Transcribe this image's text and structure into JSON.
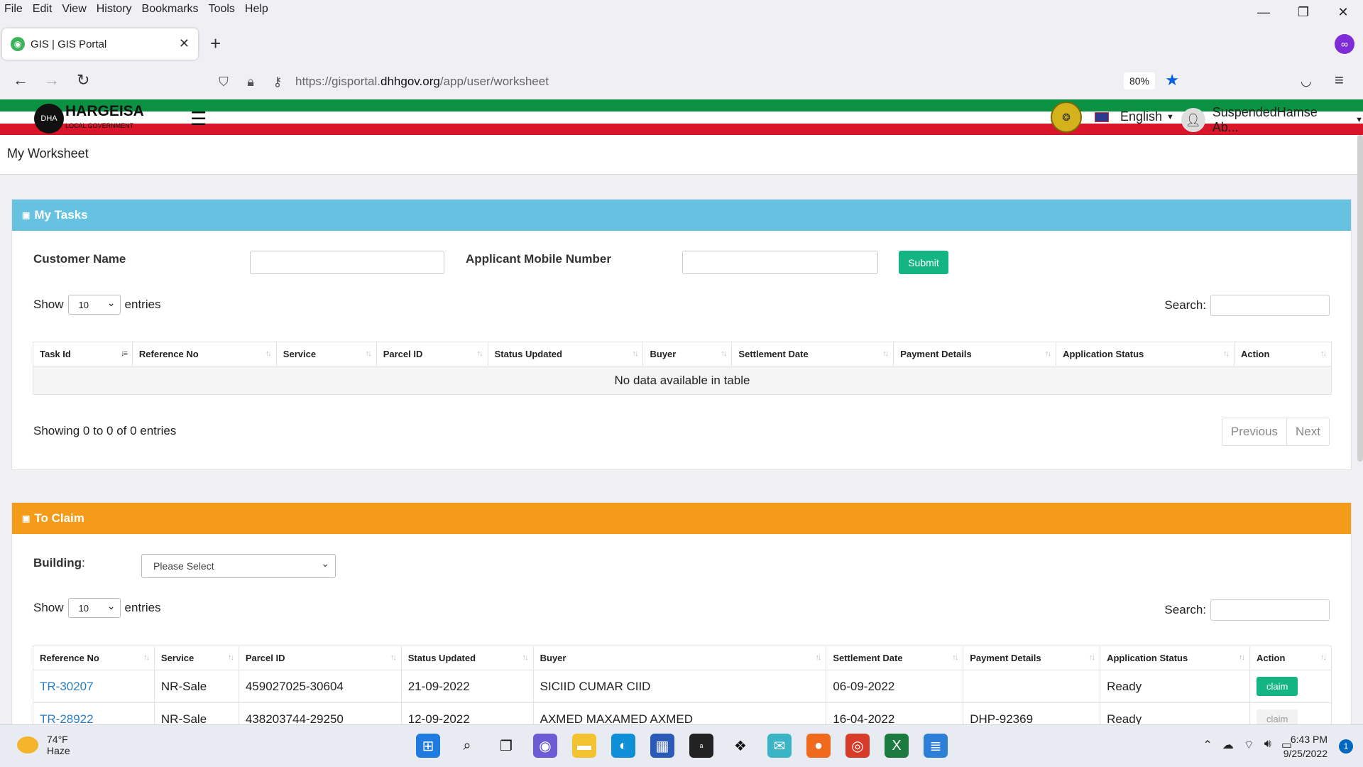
{
  "browser": {
    "menu": [
      "File",
      "Edit",
      "View",
      "History",
      "Bookmarks",
      "Tools",
      "Help"
    ],
    "tab_title": "GIS | GIS Portal",
    "url_prefix": "https://gisportal.",
    "url_domain": "dhhgov.org",
    "url_path": "/app/user/worksheet",
    "zoom": "80%"
  },
  "header": {
    "logo_initials": "DHA",
    "logo_title": "HARGEISA",
    "logo_subtitle": "LOCAL GOVERNMENT",
    "language": "English",
    "user_name": "SuspendedHamse Ab..."
  },
  "breadcrumb": "My Worksheet",
  "my_tasks": {
    "title": "My Tasks",
    "customer_name_label": "Customer Name",
    "mobile_label": "Applicant Mobile Number",
    "submit_label": "Submit",
    "show_label": "Show",
    "entries_label": "entries",
    "page_size": "10",
    "search_label": "Search:",
    "columns": [
      "Task Id",
      "Reference No",
      "Service",
      "Parcel ID",
      "Status Updated",
      "Buyer",
      "Settlement Date",
      "Payment Details",
      "Application Status",
      "Action"
    ],
    "empty_text": "No data available in table",
    "info_text": "Showing 0 to 0 of 0 entries",
    "prev_label": "Previous",
    "next_label": "Next"
  },
  "to_claim": {
    "title": "To Claim",
    "building_label": "Building",
    "building_colon": ":",
    "building_placeholder": "Please Select",
    "show_label": "Show",
    "entries_label": "entries",
    "page_size": "10",
    "search_label": "Search:",
    "columns": [
      "Reference No",
      "Service",
      "Parcel ID",
      "Status Updated",
      "Buyer",
      "Settlement Date",
      "Payment Details",
      "Application Status",
      "Action"
    ],
    "rows": [
      {
        "ref": "TR-30207",
        "service": "NR-Sale",
        "parcel": "459027025-30604",
        "status_updated": "21-09-2022",
        "buyer": "SICIID CUMAR CIID",
        "settlement": "06-09-2022",
        "payment": "",
        "app_status": "Ready",
        "action": "claim"
      },
      {
        "ref": "TR-28922",
        "service": "NR-Sale",
        "parcel": "438203744-29250",
        "status_updated": "12-09-2022",
        "buyer": "AXMED MAXAMED AXMED",
        "settlement": "16-04-2022",
        "payment": "DHP-92369",
        "app_status": "Ready",
        "action": "claim"
      }
    ]
  },
  "taskbar": {
    "temp": "74°F",
    "condition": "Haze",
    "time": "6:43 PM",
    "date": "9/25/2022",
    "notifications": "1"
  },
  "colors": {
    "my_tasks_header": "#67c1e0",
    "to_claim_header": "#f59b1a",
    "submit": "#14b583",
    "flag_green": "#0a9142",
    "flag_red": "#d9152a"
  }
}
